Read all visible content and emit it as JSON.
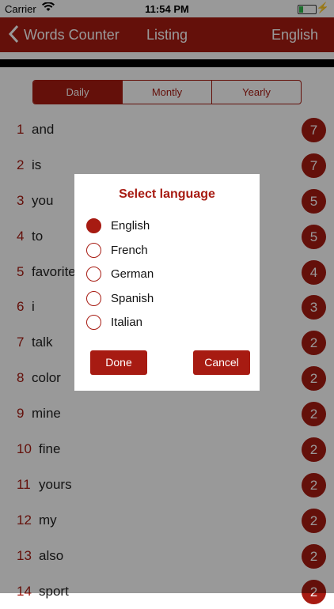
{
  "status_bar": {
    "carrier": "Carrier",
    "time": "11:54 PM"
  },
  "nav": {
    "back_label": "Words Counter",
    "title": "Listing",
    "language": "English"
  },
  "segments": [
    {
      "label": "Daily",
      "active": true
    },
    {
      "label": "Montly",
      "active": false
    },
    {
      "label": "Yearly",
      "active": false
    }
  ],
  "words": [
    {
      "rank": "1",
      "word": "and",
      "count": "7"
    },
    {
      "rank": "2",
      "word": "is",
      "count": "7"
    },
    {
      "rank": "3",
      "word": "you",
      "count": "5"
    },
    {
      "rank": "4",
      "word": "to",
      "count": "5"
    },
    {
      "rank": "5",
      "word": "favorite",
      "count": "4"
    },
    {
      "rank": "6",
      "word": "i",
      "count": "3"
    },
    {
      "rank": "7",
      "word": "talk",
      "count": "2"
    },
    {
      "rank": "8",
      "word": "color",
      "count": "2"
    },
    {
      "rank": "9",
      "word": "mine",
      "count": "2"
    },
    {
      "rank": "10",
      "word": "fine",
      "count": "2"
    },
    {
      "rank": "11",
      "word": "yours",
      "count": "2"
    },
    {
      "rank": "12",
      "word": "my",
      "count": "2"
    },
    {
      "rank": "13",
      "word": "also",
      "count": "2"
    },
    {
      "rank": "14",
      "word": "sport",
      "count": "2"
    }
  ],
  "dialog": {
    "title": "Select language",
    "options": [
      "English",
      "French",
      "German",
      "Spanish",
      "Italian"
    ],
    "selected": "English",
    "done_label": "Done",
    "cancel_label": "Cancel"
  },
  "colors": {
    "accent": "#a71b12"
  }
}
